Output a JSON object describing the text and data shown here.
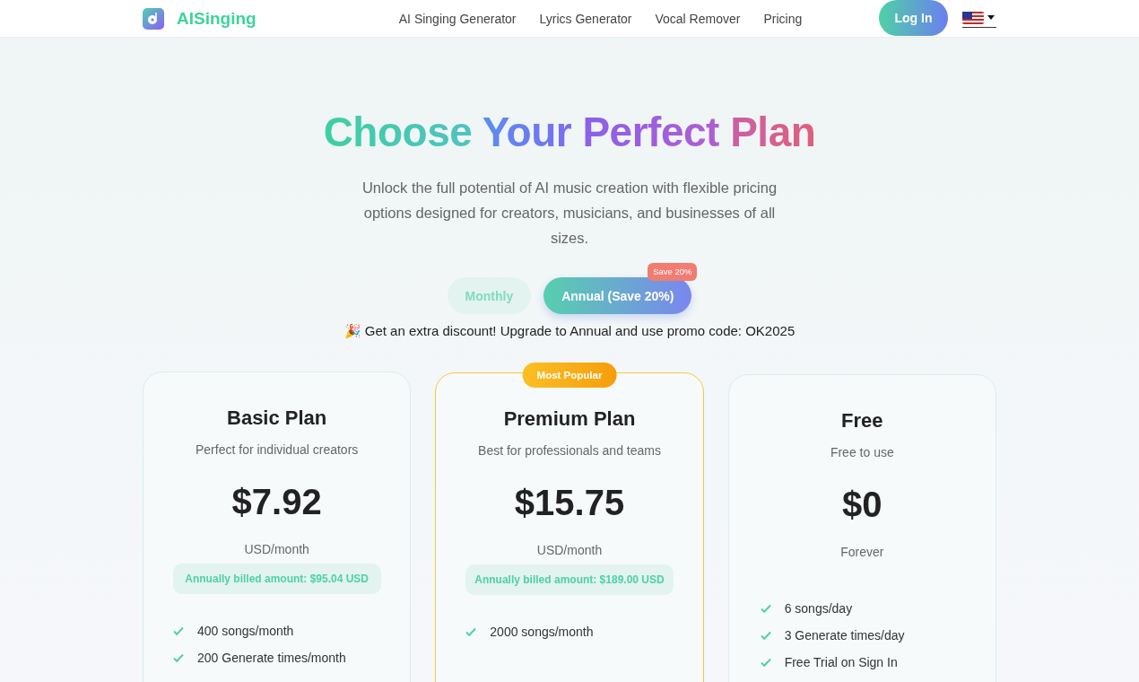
{
  "brand": {
    "name": "AISinging"
  },
  "nav": [
    {
      "label": "AI Singing Generator"
    },
    {
      "label": "Lyrics Generator"
    },
    {
      "label": "Vocal Remover"
    },
    {
      "label": "Pricing"
    }
  ],
  "login": "Log In",
  "hero": {
    "title": "Choose Your Perfect Plan",
    "subtitle": "Unlock the full potential of AI music creation with flexible pricing options designed for creators, musicians, and businesses of all sizes."
  },
  "billing": [
    {
      "label": "Monthly",
      "selected": false
    },
    {
      "label": "Annual (Save 20%)",
      "selected": true,
      "badge": "Save 20%"
    }
  ],
  "promo": {
    "emoji": "🎉",
    "text": "Get an extra discount! Upgrade to Annual and use promo code: OK2025"
  },
  "plans": [
    {
      "name": "Basic Plan",
      "tagline": "Perfect for individual creators",
      "price": "$7.92",
      "period": "USD/month",
      "billed": "Annually billed amount: $95.04 USD",
      "featured": false,
      "features": [
        "400 songs/month",
        "200 Generate times/month"
      ]
    },
    {
      "name": "Premium Plan",
      "tagline": "Best for professionals and teams",
      "price": "$15.75",
      "period": "USD/month",
      "billed": "Annually billed amount: $189.00 USD",
      "featured": true,
      "ribbon": "Most Popular",
      "features": [
        "2000 songs/month"
      ]
    },
    {
      "name": "Free",
      "tagline": "Free to use",
      "price": "$0",
      "period": "Forever",
      "featured": false,
      "features": [
        "6 songs/day",
        "3 Generate times/day",
        "Free Trial on Sign In"
      ]
    }
  ]
}
